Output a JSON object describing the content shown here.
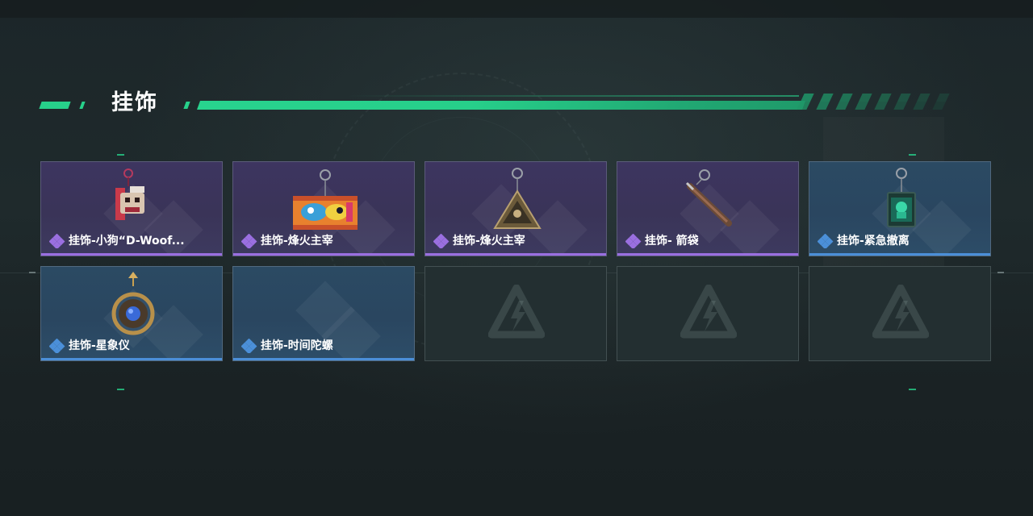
{
  "section": {
    "title": "挂饰"
  },
  "colors": {
    "accent_green": "#27d08a",
    "rarity_purple": "#9a6fe0",
    "rarity_blue": "#4b8fd8"
  },
  "items": [
    {
      "label": "挂饰-小狗“D-Woof...",
      "rarity": "purple",
      "icon": "dog-charm-icon"
    },
    {
      "label": "挂饰-烽火主宰",
      "rarity": "purple",
      "icon": "graffiti-tag-charm-icon"
    },
    {
      "label": "挂饰-烽火主宰",
      "rarity": "purple",
      "icon": "triangle-emblem-charm-icon"
    },
    {
      "label": "挂饰- 箭袋",
      "rarity": "purple",
      "icon": "quiver-charm-icon"
    },
    {
      "label": "挂饰-紧急撤离",
      "rarity": "blue",
      "icon": "evacuation-box-charm-icon"
    },
    {
      "label": "挂饰-星象仪",
      "rarity": "blue",
      "icon": "astrolabe-charm-icon"
    },
    {
      "label": "挂饰-时间陀螺",
      "rarity": "blue",
      "icon": ""
    }
  ],
  "empty_slots": 3
}
